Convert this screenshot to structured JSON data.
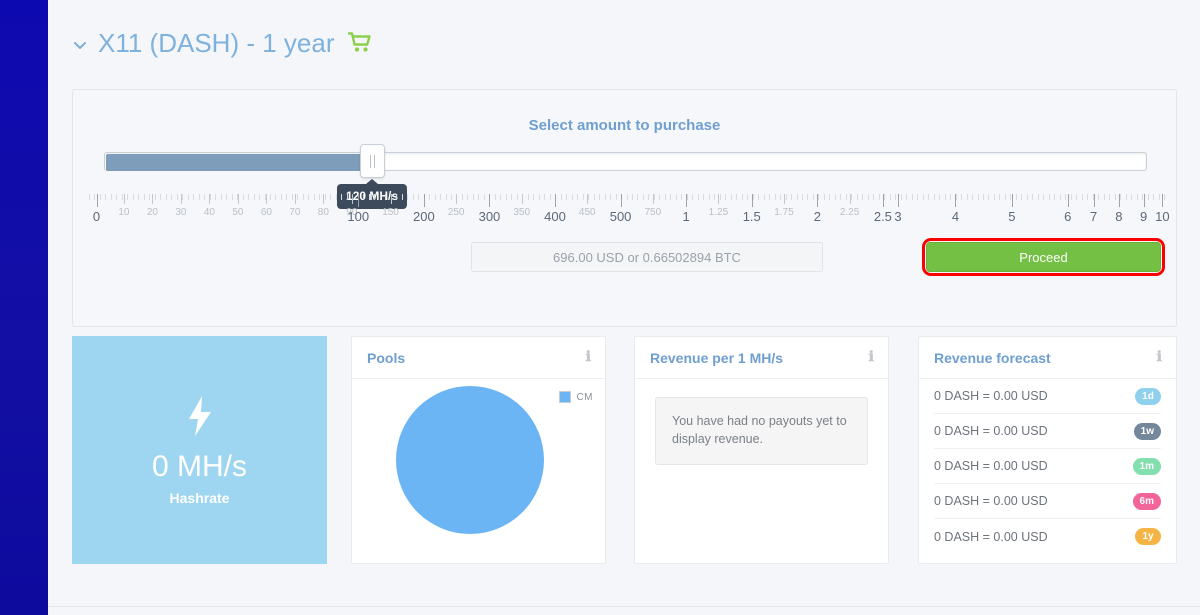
{
  "theme": {
    "sidebar_color": "#100ca8",
    "page_bg": "#f4f6f9",
    "accent_blue": "#6f9fd0",
    "proceed_green": "#74c044",
    "highlight_red": "#fb0000",
    "hashrate_tile": "#9ed5f0",
    "pie_blue": "#6cb5f4"
  },
  "header": {
    "title": "X11 (DASH) - 1 year",
    "chevron_icon": "chevron-down-icon",
    "cart_icon": "shopping-cart-icon"
  },
  "purchase": {
    "heading": "Select amount to purchase",
    "slider": {
      "tooltip": "120 MH/s",
      "value": 120,
      "fill_percent": 25.1,
      "handle_percent": 25.7,
      "grip_icon": "drag-grip-icon"
    },
    "ruler": {
      "major_labels": [
        "0",
        "100",
        "200",
        "300",
        "400",
        "500",
        "1",
        "1.5",
        "2",
        "2.5",
        "3",
        "4",
        "5",
        "6",
        "7",
        "8",
        "9",
        "10"
      ],
      "minor_labels": [
        "10",
        "20",
        "30",
        "40",
        "50",
        "60",
        "70",
        "80",
        "90",
        "150",
        "250",
        "350",
        "450",
        "750",
        "1.25",
        "1.75",
        "2.25"
      ]
    },
    "price": "696.00 USD or 0.66502894 BTC",
    "proceed_label": "Proceed"
  },
  "hashrate_tile": {
    "icon": "lightning-bolt-icon",
    "value": "0 MH/s",
    "label": "Hashrate"
  },
  "pools_card": {
    "title": "Pools",
    "info_icon": "info-icon",
    "legend": [
      {
        "label": "CM",
        "color": "#6cb5f4",
        "value": 100
      }
    ]
  },
  "revenue_card": {
    "title": "Revenue per 1 MH/s",
    "info_icon": "info-icon",
    "empty_message": "You have had no payouts yet to display revenue."
  },
  "forecast_card": {
    "title": "Revenue forecast",
    "info_icon": "info-icon",
    "rows": [
      {
        "text": "0 DASH = 0.00 USD",
        "badge": "1d",
        "color": "#8fd0ee"
      },
      {
        "text": "0 DASH = 0.00 USD",
        "badge": "1w",
        "color": "#74879b"
      },
      {
        "text": "0 DASH = 0.00 USD",
        "badge": "1m",
        "color": "#84dfae"
      },
      {
        "text": "0 DASH = 0.00 USD",
        "badge": "6m",
        "color": "#f2649a"
      },
      {
        "text": "0 DASH = 0.00 USD",
        "badge": "1y",
        "color": "#f4b546"
      }
    ]
  },
  "chart_data": {
    "type": "pie",
    "title": "Pools",
    "categories": [
      "CM"
    ],
    "values": [
      100
    ],
    "colors": [
      "#6cb5f4"
    ],
    "legend_position": "top-right",
    "labels_shown": false
  }
}
